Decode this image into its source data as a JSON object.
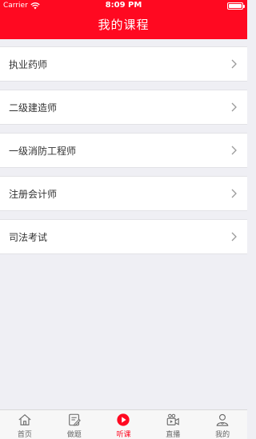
{
  "status_bar": {
    "carrier": "Carrier",
    "time": "8:09 PM",
    "battery_level": 1.0
  },
  "nav": {
    "title": "我的课程"
  },
  "courses": [
    {
      "label": "执业药师"
    },
    {
      "label": "二级建造师"
    },
    {
      "label": "一级消防工程师"
    },
    {
      "label": "注册会计师"
    },
    {
      "label": "司法考试"
    }
  ],
  "tabbar": {
    "accent_color": "#ff0921",
    "tabs": [
      {
        "label": "首页",
        "icon": "home-icon",
        "active": false
      },
      {
        "label": "做题",
        "icon": "edit-icon",
        "active": false
      },
      {
        "label": "听课",
        "icon": "play-icon",
        "active": true
      },
      {
        "label": "直播",
        "icon": "live-camera-icon",
        "active": false
      },
      {
        "label": "我的",
        "icon": "user-icon",
        "active": false
      }
    ]
  }
}
